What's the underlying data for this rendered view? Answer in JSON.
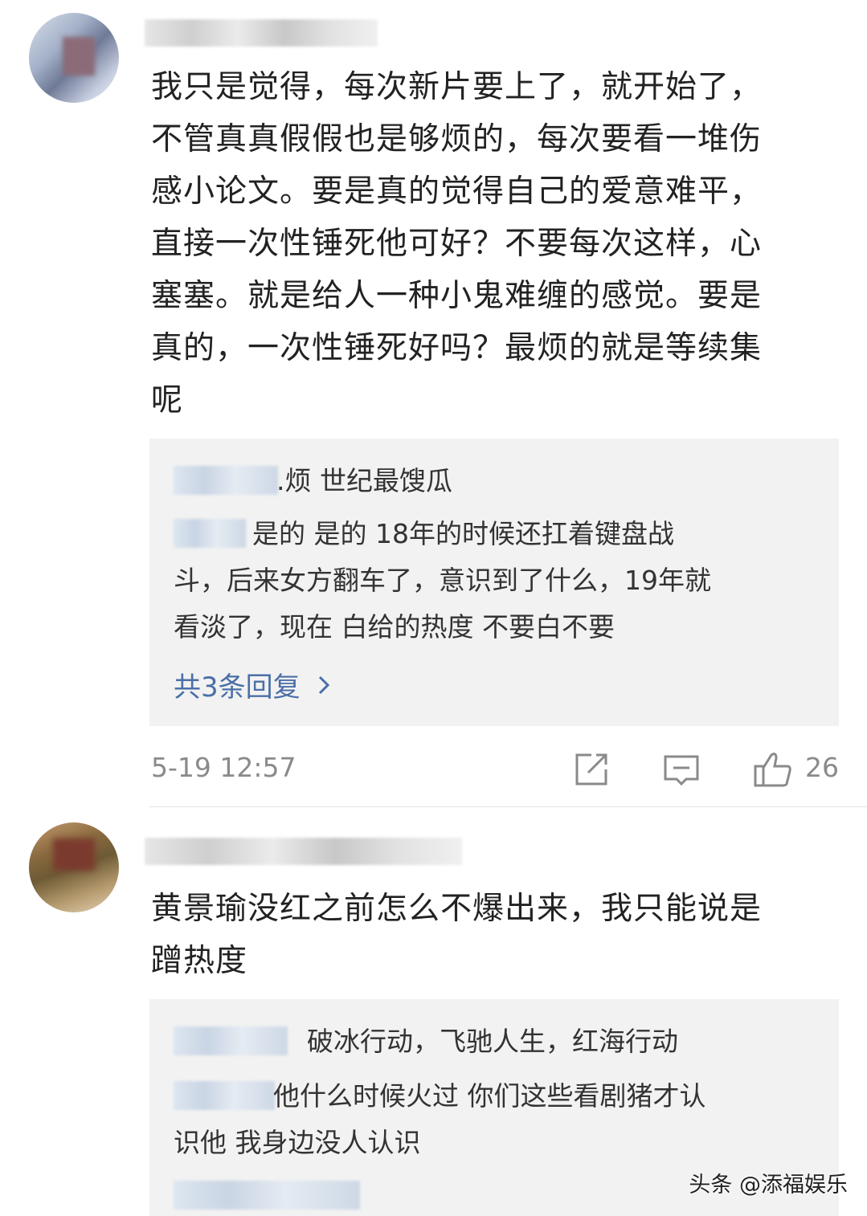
{
  "comments": [
    {
      "text_lines": [
        "我只是觉得，每次新片要上了，就开始了，",
        "不管真真假假也是够烦的，每次要看一堆伤",
        "感小论文。要是真的觉得自己的爱意难平，",
        "直接一次性锤死他可好？不要每次这样，心",
        "塞塞。就是给人一种小鬼难缠的感觉。要是",
        "真的，一次性锤死好吗？最烦的就是等续集",
        "呢"
      ],
      "replies": [
        {
          "text": ".烦 世纪最馊瓜"
        },
        {
          "text_lines": [
            "是的  是的   18年的时候还扛着键盘战",
            "斗，后来女方翻车了，意识到了什么，19年就",
            "看淡了，现在   白给的热度   不要白不要"
          ]
        }
      ],
      "more_replies": "共3条回复",
      "time": "5-19 12:57",
      "likes": "26"
    },
    {
      "text_lines": [
        "黄景瑜没红之前怎么不爆出来，我只能说是",
        "蹭热度"
      ],
      "replies": [
        {
          "text": "破冰行动，飞驰人生，红海行动"
        },
        {
          "text_lines": [
            "他什么时候火过 你们这些看剧猪才认",
            "识他 我身边没人认识"
          ]
        }
      ]
    }
  ],
  "watermark": "头条 @添福娱乐",
  "icons": {
    "share": "share-icon",
    "comment": "comment-icon",
    "like": "like-icon",
    "chevron": "chevron-right-icon"
  },
  "colors": {
    "link": "#4b6fa7",
    "meta": "#8a8a8a",
    "reply_bg": "#f2f2f2"
  }
}
